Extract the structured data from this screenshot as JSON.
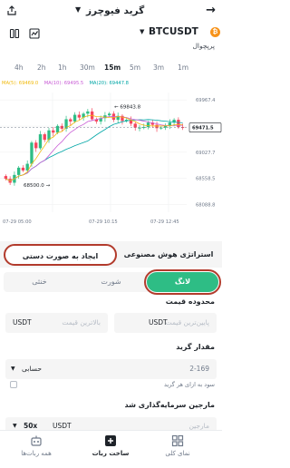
{
  "header": {
    "title": "گرید فیوچرز",
    "back_icon": "arrow-right-icon",
    "share_icon": "share-icon"
  },
  "pair": {
    "symbol": "BTCUSDT",
    "type": "پرپچوال",
    "coin_glyph": "₿"
  },
  "intervals": [
    "4h",
    "2h",
    "1h",
    "30m",
    "15m",
    "5m",
    "3m",
    "1m"
  ],
  "active_interval": "15m",
  "chart": {
    "ma_labels": [
      {
        "text": "MA(5): 69469.0",
        "color": "#f0b90b"
      },
      {
        "text": "MA(10): 69495.5",
        "color": "#c85cd5"
      },
      {
        "text": "MA(20): 69447.8",
        "color": "#00a6a6"
      }
    ],
    "price_ticks": [
      "69967.4",
      "69497.1",
      "69027.7",
      "68558.5",
      "68088.8"
    ],
    "current_price": "69471.5",
    "high_label": "69843.8",
    "low_label": "68500.0",
    "time_ticks": [
      "07-29 05:00",
      "07-29 10:15",
      "07-29 12:45"
    ]
  },
  "strategy": {
    "ai": "استراتژی هوش مصنوعی",
    "manual": "ایجاد به صورت دستی"
  },
  "sides": {
    "long": "لانگ",
    "short": "شورت",
    "neutral": "خنثی"
  },
  "price_range": {
    "label": "محدوده قیمت",
    "min_placeholder": "پایین‌ترین قیمت",
    "max_placeholder": "بالاترین قیمت",
    "unit": "USDT"
  },
  "grid": {
    "label": "مقدار گرید",
    "placeholder": "2-169",
    "mode": "حسابی",
    "hint": "سود به ازای هر گرید"
  },
  "margin": {
    "label": "مارجین سرمایه‌گذاری شد",
    "placeholder": "مارجین",
    "unit": "USDT",
    "leverage": "50x"
  },
  "nav": {
    "overview": "نمای کلی",
    "create": "ساخت ربات",
    "all": "همه ربات‌ها"
  }
}
